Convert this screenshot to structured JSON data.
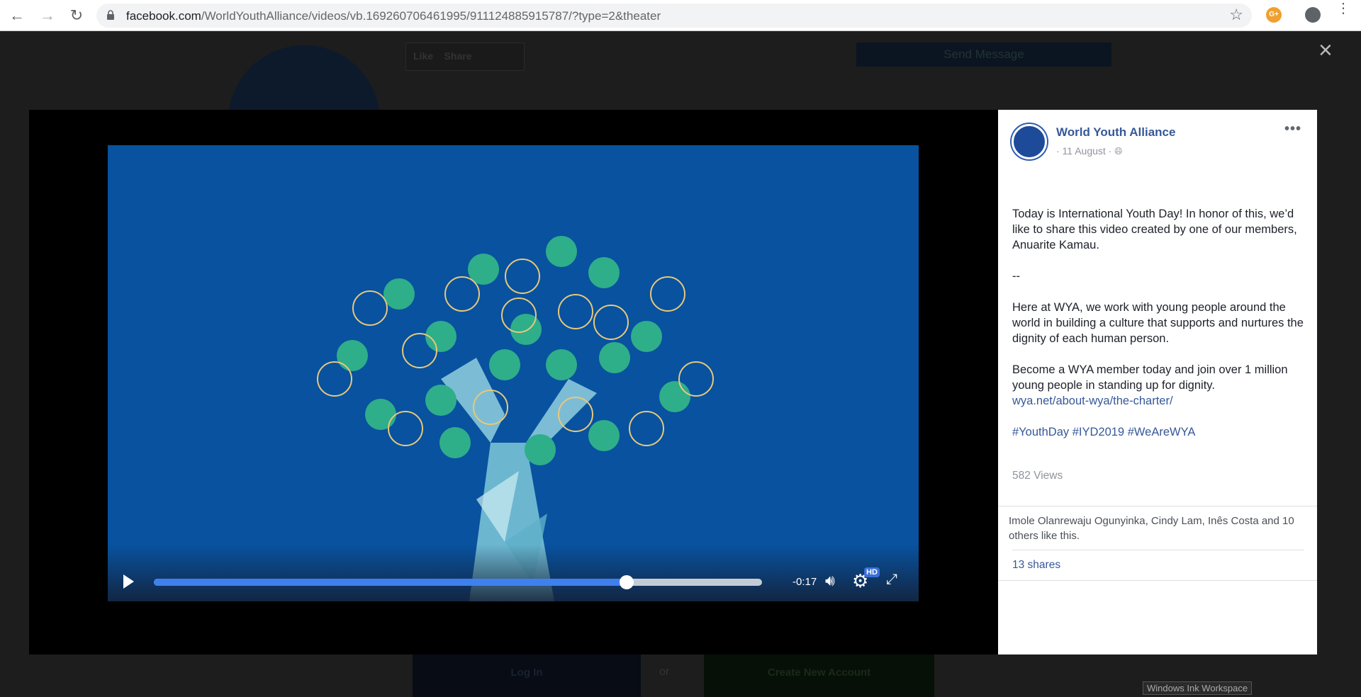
{
  "browser": {
    "url_host": "facebook.com",
    "url_path": "/WorldYouthAlliance/videos/vb.169260706461995/911124885915787/?type=2&theater",
    "ext_label": "G+"
  },
  "background": {
    "like": "Like",
    "share": "Share",
    "send_message": "Send Message",
    "log_in": "Log In",
    "or": "or",
    "create_account": "Create New Account"
  },
  "close": "×",
  "player": {
    "remaining": "-0:17",
    "progress": 0.777,
    "quality": "HD"
  },
  "post": {
    "page_name": "World Youth Alliance",
    "date": "· 11 August ·",
    "more": "•••",
    "paragraphs": [
      "Today is International Youth Day! In honor of this, we’d like to share this video created by one of our members, Anuarite Kamau.",
      "--",
      "Here at WYA, we work with young people around the world in building a culture that supports and nurtures the dignity of each human person."
    ],
    "para4": "Become a WYA member today and join over 1 million young people in standing up for dignity.",
    "link": "wya.net/about-wya/the-charter/",
    "hashtags": [
      "#YouthDay",
      "#IYD2019",
      "#WeAreWYA"
    ],
    "views": "582 Views",
    "likes": "Imole Olanrewaju Ogunyinka, Cindy Lam, Inês Costa and 10 others like this.",
    "shares": "13 shares"
  },
  "taskbar_tooltip": "Windows Ink Workspace",
  "colors": {
    "fb_blue": "#365899",
    "video_bg": "#08529f",
    "progress": "#4080ee"
  }
}
